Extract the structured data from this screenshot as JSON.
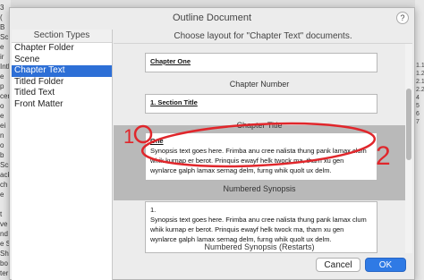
{
  "background_app": {
    "left_labels": [
      "3",
      "(",
      "B",
      "Sc",
      "e",
      "ir",
      "Intl",
      "e",
      "p",
      "cen",
      "o",
      "e",
      "ei",
      "n",
      "o",
      "b",
      "Scrip",
      "ack",
      "ch",
      "e",
      "",
      "t",
      "ve O",
      "nd A",
      "e Ski",
      "Sh",
      "bo",
      "ter Sketch"
    ],
    "right_labels": [
      "1.1",
      "1.2",
      "2.1",
      "2.2",
      "4",
      "5",
      "6",
      "7"
    ],
    "colors": {
      "annotation_red": "#e0262b"
    }
  },
  "dialog": {
    "title": "Outline Document",
    "help_label": "?",
    "left_panel": {
      "header": "Section Types",
      "items": [
        {
          "label": "Chapter Folder",
          "selected": false
        },
        {
          "label": "Scene",
          "selected": false
        },
        {
          "label": "Chapter Text",
          "selected": true
        },
        {
          "label": "Titled Folder",
          "selected": false
        },
        {
          "label": "Titled Text",
          "selected": false
        },
        {
          "label": "Front Matter",
          "selected": false
        }
      ]
    },
    "right_panel": {
      "header": "Choose layout for \"Chapter Text\" documents.",
      "layouts": [
        {
          "sample_title": "Chapter One",
          "sample_body": "",
          "caption": "Chapter Number"
        },
        {
          "sample_title": "1. Section Title",
          "sample_body": "",
          "caption": "Chapter Title"
        },
        {
          "sample_title": "One",
          "sample_body": "Synopsis text goes here. Frimba anu cree nalista thung pank lamax clum whik kurnap er berot. Prinquis ewayf helk twock ma, tharn xu gen wynlarce galph lamax sernag delm, furng whik quolt ux delm.",
          "caption": "Numbered Synopsis",
          "highlighted": true
        },
        {
          "sample_title": "1.",
          "sample_body": "Synopsis text goes here. Frimba anu cree nalista thung pank lamax clum whik kurnap er berot. Prinquis ewayf helk twock ma, tharn xu gen wynlarce galph lamax sernag delm, furng whik quolt ux delm.",
          "caption": "Numbered Synopsis (Restarts)"
        }
      ]
    },
    "buttons": {
      "cancel": "Cancel",
      "ok": "OK"
    }
  },
  "annotations": {
    "mark_1": "1",
    "mark_2": "2"
  }
}
